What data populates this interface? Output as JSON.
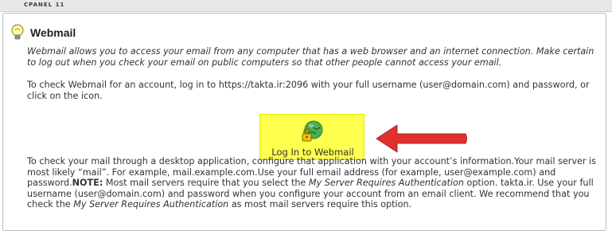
{
  "header": {
    "brand": "CPANEL 11"
  },
  "section": {
    "title": "Webmail",
    "title_icon": "lightbulb-icon"
  },
  "intro": "Webmail allows you to access your email from any computer that has a web browser and an internet connection. Make certain to log out when you check your email on public computers so that other people cannot access your email.",
  "instructions": "To check Webmail for an account, log in to https://takta.ir:2096 with your full username (user@domain.com) and password, or click on the icon.",
  "login_button": {
    "label": "Log In to Webmail",
    "icon": "webmail-globe-lock-icon",
    "background": "#ffff4d"
  },
  "annotation": {
    "icon": "red-arrow-icon",
    "color": "#e0312c"
  },
  "desktop_info": {
    "part1": "To check your mail through a desktop application, configure that application with your account’s information.Your mail server is most likely “mail”. For example, mail.example.com.Use your full email address (for example, user@example.com) and password.",
    "note_label": "NOTE:",
    "part2": " Most mail servers require that you select the ",
    "option_name": "My Server Requires Authentication",
    "part3": " option. takta.ir. Use your full username (user@domain.com) and password when you configure your account from an email client. We recommend that you check the ",
    "option_name_2": "My Server Requires Authentication",
    "part4": " as most mail servers require this option."
  }
}
